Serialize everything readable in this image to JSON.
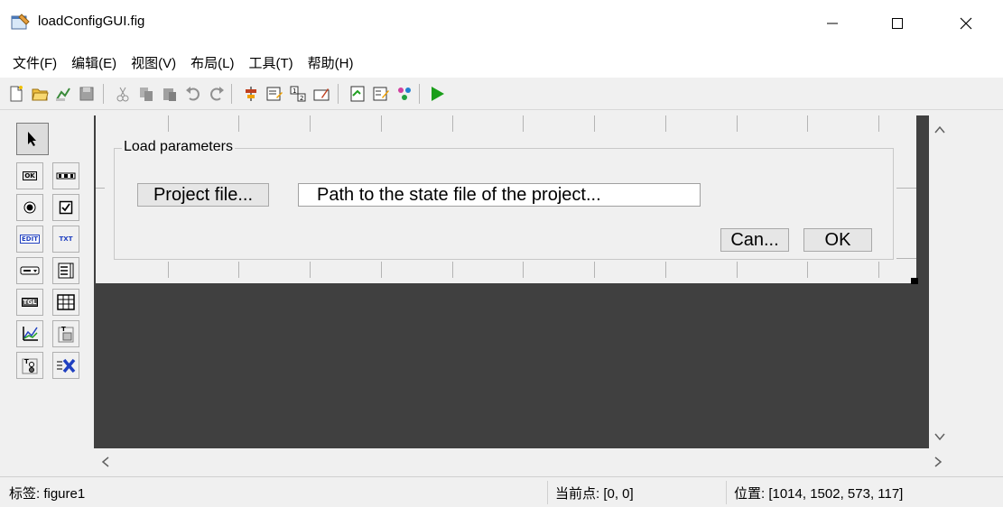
{
  "window": {
    "title": "loadConfigGUI.fig",
    "minimize_glyph": "—",
    "maximize_glyph": "☐",
    "close_glyph": "✕"
  },
  "menu": {
    "items": [
      {
        "label": "文件(F)"
      },
      {
        "label": "编辑(E)"
      },
      {
        "label": "视图(V)"
      },
      {
        "label": "布局(L)"
      },
      {
        "label": "工具(T)"
      },
      {
        "label": "帮助(H)"
      }
    ]
  },
  "toolbar": {
    "icons": [
      "new-file-icon",
      "open-folder-icon",
      "save-as-icon",
      "save-icon",
      "cut-icon",
      "copy-icon",
      "paste-icon",
      "undo-icon",
      "redo-icon",
      "align-icon",
      "menu-editor-icon",
      "tab-order-icon",
      "toolbar-editor-icon",
      "editor-icon",
      "property-inspector-icon",
      "object-browser-icon",
      "run-icon"
    ]
  },
  "palette": {
    "labels": {
      "pushbutton": "OK",
      "edit": "EDIT",
      "text": "TXT",
      "toggle": "TGL"
    }
  },
  "gui": {
    "panel_title": "Load parameters",
    "project_button": "Project file...",
    "path_field": "Path to the state file of the project...",
    "cancel_button": "Can...",
    "ok_button": "OK"
  },
  "status": {
    "tag": "标签: figure1",
    "current_point": "当前点: [0, 0]",
    "position": "位置: [1014, 1502, 573, 117]"
  },
  "colors": {
    "canvas_background": "#404040",
    "figure_background": "#f0f0f0",
    "run_green": "#1a9e1a"
  }
}
